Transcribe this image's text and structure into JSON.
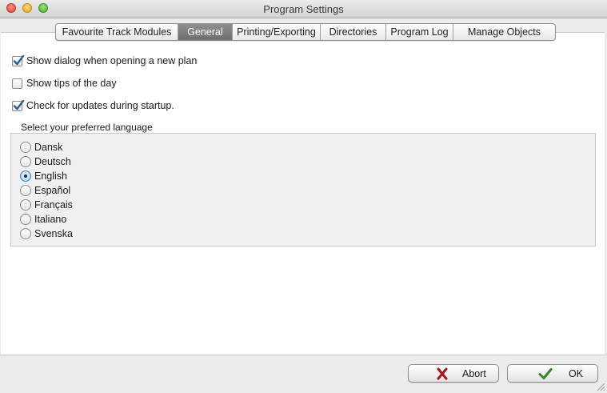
{
  "window": {
    "title": "Program Settings"
  },
  "tabs": [
    {
      "label": "Favourite Track Modules",
      "active": false
    },
    {
      "label": "General",
      "active": true
    },
    {
      "label": "Printing/Exporting",
      "active": false
    },
    {
      "label": "Directories",
      "active": false
    },
    {
      "label": "Program Log",
      "active": false
    },
    {
      "label": "Manage Objects",
      "active": false
    }
  ],
  "options": [
    {
      "label": "Show dialog when opening a new plan",
      "checked": true
    },
    {
      "label": "Show tips of the day",
      "checked": false
    },
    {
      "label": "Check for updates during startup.",
      "checked": true
    }
  ],
  "language": {
    "label": "Select your preferred language",
    "selected": "English",
    "options": [
      "Dansk",
      "Deutsch",
      "English",
      "Español",
      "Français",
      "Italiano",
      "Svenska"
    ]
  },
  "buttons": {
    "abort_label": "Abort",
    "ok_label": "OK"
  },
  "colors": {
    "check": "#2b5e93",
    "abort_icon": "#a3161c",
    "ok_icon": "#2e8a1e",
    "active_tab": "#7a7a7a"
  }
}
